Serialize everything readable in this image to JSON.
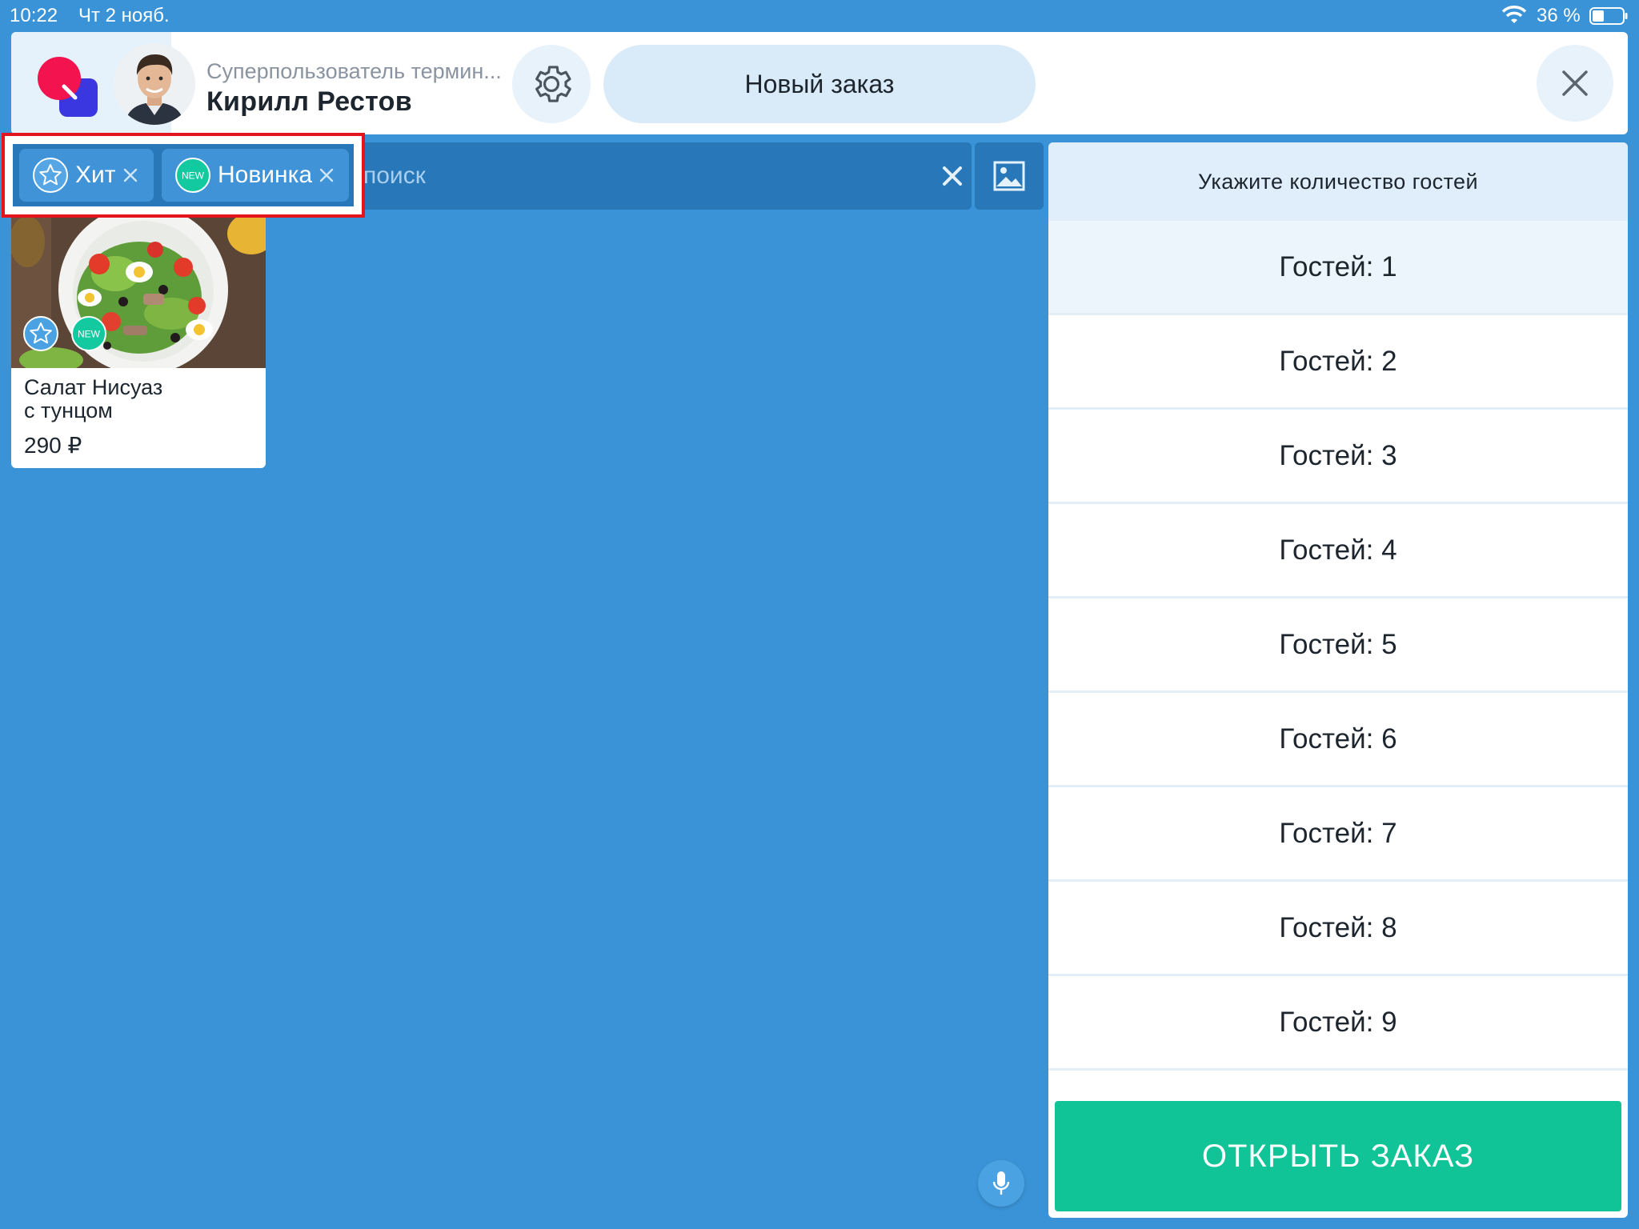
{
  "status_bar": {
    "time": "10:22",
    "date": "Чт 2 нояб.",
    "battery": "36 %"
  },
  "header": {
    "user_role": "Суперпользователь термин...",
    "user_name": "Кирилл Рестов",
    "new_order_label": "Новый заказ"
  },
  "filters": {
    "chips": [
      {
        "label": "Хит",
        "icon": "star-icon"
      },
      {
        "label": "Новинка",
        "icon": "new-badge-icon",
        "icon_text": "NEW"
      }
    ]
  },
  "search": {
    "placeholder": "поиск"
  },
  "products": [
    {
      "name_line1": "Салат Нисуаз",
      "name_line2": "с тунцом",
      "price": "290 ₽",
      "badges": [
        "star-icon",
        "NEW"
      ]
    }
  ],
  "guest_panel": {
    "title": "Укажите количество гостей",
    "options": [
      "Гостей: 1",
      "Гостей: 2",
      "Гостей: 3",
      "Гостей: 4",
      "Гостей: 5",
      "Гостей: 6",
      "Гостей: 7",
      "Гостей: 8",
      "Гостей: 9"
    ],
    "selected_index": 0,
    "open_order_label": "ОТКРЫТЬ ЗАКАЗ"
  },
  "colors": {
    "background": "#3a93d6",
    "accent_green": "#10c497",
    "highlight_red": "#e3141c",
    "new_badge": "#12c9a0"
  }
}
